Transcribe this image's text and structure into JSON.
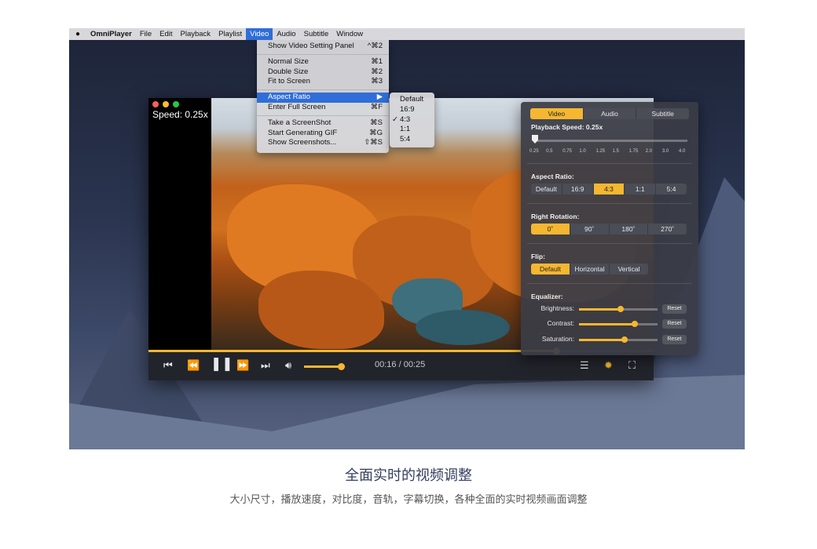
{
  "menubar": {
    "app_name": "OmniPlayer",
    "items": [
      "File",
      "Edit",
      "Playback",
      "Playlist",
      "Video",
      "Audio",
      "Subtitle",
      "Window"
    ],
    "active": "Video"
  },
  "video_menu": {
    "items": [
      {
        "label": "Show Video Setting Panel",
        "shortcut": "^⌘2"
      },
      {
        "label": "Normal Size",
        "shortcut": "⌘1"
      },
      {
        "label": "Double Size",
        "shortcut": "⌘2"
      },
      {
        "label": "Fit to Screen",
        "shortcut": "⌘3"
      },
      {
        "label": "Aspect Ratio",
        "shortcut": "▶"
      },
      {
        "label": "Enter Full Screen",
        "shortcut": "⌘F"
      },
      {
        "label": "Take a ScreenShot",
        "shortcut": "⌘S"
      },
      {
        "label": "Start Generating GIF",
        "shortcut": "⌘G"
      },
      {
        "label": "Show Screenshots...",
        "shortcut": "⇧⌘S"
      }
    ]
  },
  "aspect_submenu": {
    "items": [
      "Default",
      "16:9",
      "4:3",
      "1:1",
      "5:4"
    ],
    "checked": "4:3",
    "checkmark": "✓"
  },
  "player": {
    "speed_overlay": "Speed: 0.25x",
    "progress": 0.807,
    "volume": 0.9,
    "time": "00:16 / 00:25"
  },
  "panel": {
    "tabs": [
      "Video",
      "Audio",
      "Subtitle"
    ],
    "active_tab": "Video",
    "playback_speed_label": "Playback Speed: 0.25x",
    "speed_ticks": [
      "0.25",
      "0.5",
      "0.75",
      "1.0",
      "1.25",
      "1.5",
      "1.75",
      "2.0",
      "3.0",
      "4.0"
    ],
    "aspect_label": "Aspect Ratio:",
    "aspect_options": [
      "Default",
      "16:9",
      "4:3",
      "1:1",
      "5:4"
    ],
    "aspect_selected": "4:3",
    "rotation_label": "Right Rotation:",
    "rotation_options": [
      "0˚",
      "90˚",
      "180˚",
      "270˚"
    ],
    "rotation_selected": "0˚",
    "flip_label": "Flip:",
    "flip_options": [
      "Default",
      "Horizontal",
      "Vertical"
    ],
    "flip_selected": "Default",
    "equalizer_label": "Equalizer:",
    "equalizer": [
      {
        "label": "Brightness:",
        "value": 0.53,
        "reset": "Reset"
      },
      {
        "label": "Contrast:",
        "value": 0.71,
        "reset": "Reset"
      },
      {
        "label": "Saturation:",
        "value": 0.58,
        "reset": "Reset"
      }
    ]
  },
  "caption": {
    "heading": "全面实时的视频调整",
    "subheading": "大小尺寸，播放速度，对比度，音轨，字幕切换，各种全面的实时视频画面调整"
  },
  "colors": {
    "accent": "#f5b731",
    "menu_highlight": "#2f6ed8",
    "traffic_red": "#ff5f57",
    "traffic_yellow": "#febc2e",
    "traffic_green": "#28c840"
  }
}
